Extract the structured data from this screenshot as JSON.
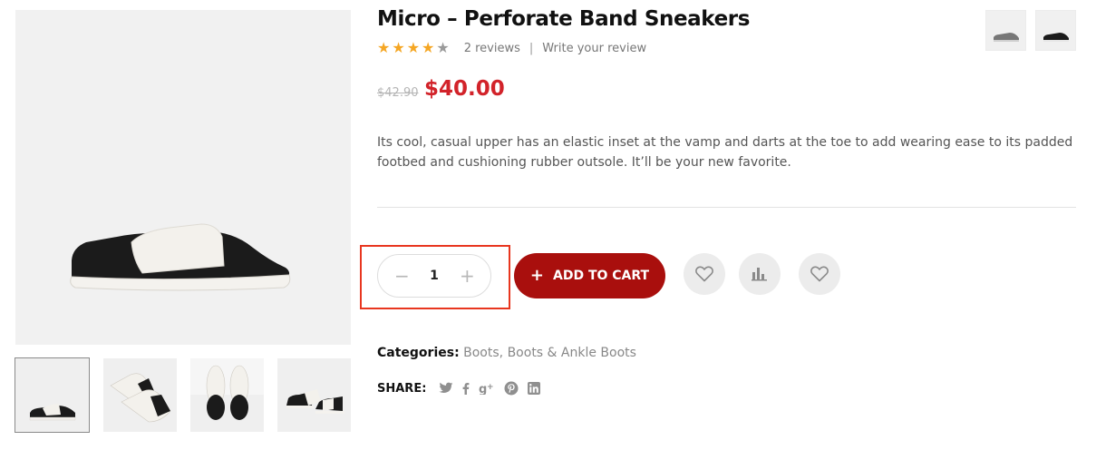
{
  "product": {
    "title": "Micro – Perforate Band Sneakers",
    "rating": 4,
    "rating_max": 5,
    "reviews_label": "2 reviews",
    "separator": "|",
    "write_review_label": "Write your review",
    "price_old": "$42.90",
    "price_new": "$40.00",
    "description": "Its cool, casual upper has an elastic inset at the vamp and darts at the toe to add wearing ease to its padded footbed and cushioning rubber outsole. It’ll be your new favorite."
  },
  "quantity": {
    "value": "1",
    "minus_icon": "minus-icon",
    "plus_icon": "plus-icon"
  },
  "actions": {
    "add_to_cart_label": "ADD TO CART",
    "wishlist_icon": "heart-icon",
    "compare_icon": "bar-chart-icon",
    "favorite_icon": "heart-icon"
  },
  "categories": {
    "label": "Categories:",
    "items": [
      "Boots",
      "Boots & Ankle Boots"
    ],
    "separator": ","
  },
  "share": {
    "label": "SHARE:",
    "icons": [
      "twitter-icon",
      "facebook-icon",
      "google-plus-icon",
      "pinterest-icon",
      "linkedin-icon"
    ]
  },
  "colors": {
    "price_new": "#d2232a",
    "add_to_cart_bg": "#a90f0d",
    "star_on": "#f5a623",
    "highlight_border": "#e8361f"
  }
}
